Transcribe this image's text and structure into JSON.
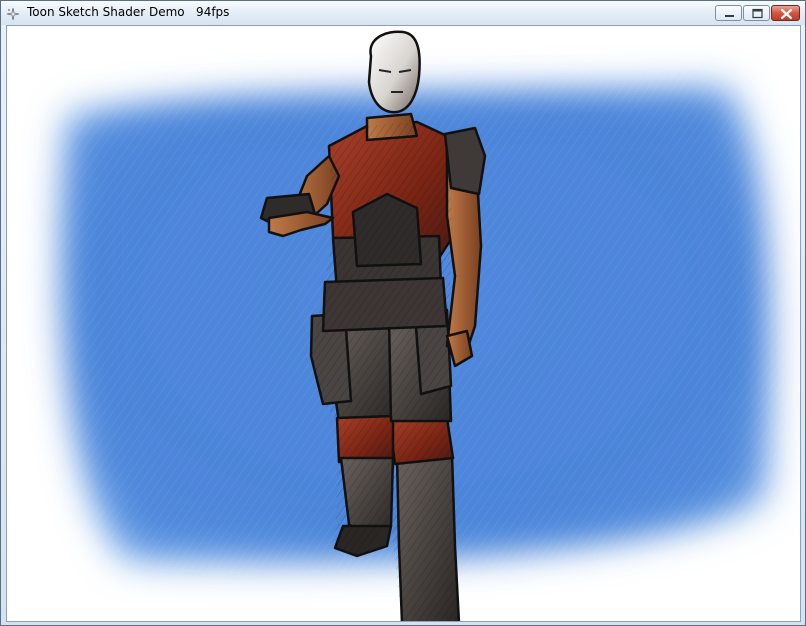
{
  "window": {
    "title": "Toon Sketch Shader Demo   94fps",
    "minimize_label": "",
    "maximize_label": "",
    "close_label": ""
  },
  "viewport": {
    "scene": "3d-render",
    "character": "armored-soldier",
    "style": "toon-sketch"
  },
  "colors": {
    "sky_blue": "#4f87dc",
    "sky_edge": "#ffffff",
    "armor_red": "#8a2c1a",
    "armor_dark": "#3b3634",
    "skin": "#b06a3a",
    "close_button": "#c8442f"
  },
  "icons": {
    "app": "sparkle-icon",
    "minimize": "minimize-icon",
    "maximize": "maximize-icon",
    "close": "close-icon"
  }
}
